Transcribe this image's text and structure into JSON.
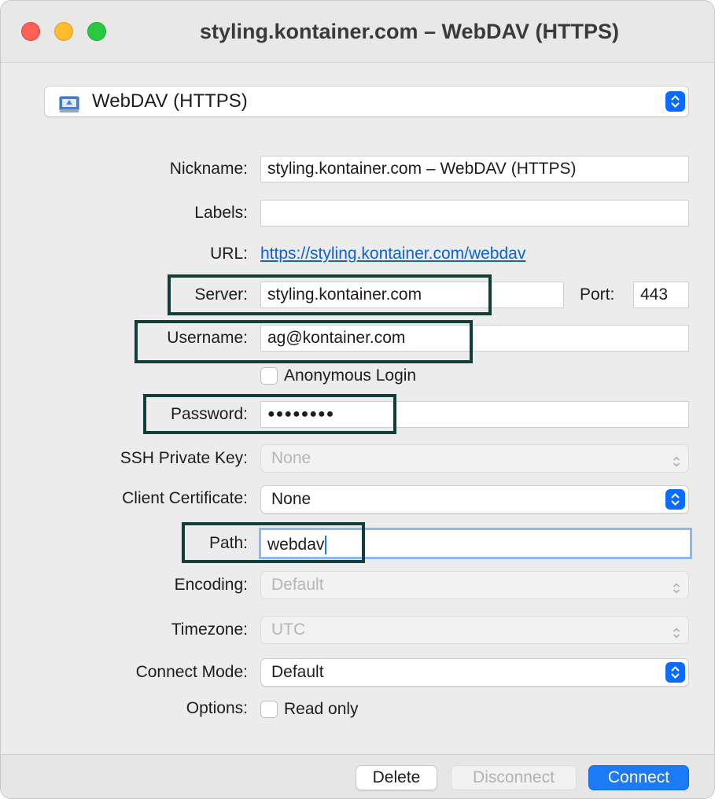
{
  "window": {
    "title": "styling.kontainer.com – WebDAV (HTTPS)"
  },
  "protocol": {
    "selected": "WebDAV (HTTPS)",
    "icon": "network-drive-icon"
  },
  "form": {
    "nickname": {
      "label": "Nickname:",
      "value": "styling.kontainer.com – WebDAV (HTTPS)"
    },
    "labels": {
      "label": "Labels:",
      "value": ""
    },
    "url": {
      "label": "URL:",
      "value": "https://styling.kontainer.com/webdav"
    },
    "server": {
      "label": "Server:",
      "value": "styling.kontainer.com"
    },
    "port": {
      "label": "Port:",
      "value": "443"
    },
    "username": {
      "label": "Username:",
      "value": "ag@kontainer.com"
    },
    "anonymous": {
      "label": "Anonymous Login",
      "checked": false
    },
    "password": {
      "label": "Password:",
      "value": "●●●●●●●●"
    },
    "ssh_key": {
      "label": "SSH Private Key:",
      "value": "None"
    },
    "client_cert": {
      "label": "Client Certificate:",
      "value": "None"
    },
    "path": {
      "label": "Path:",
      "value": "webdav"
    },
    "encoding": {
      "label": "Encoding:",
      "value": "Default"
    },
    "timezone": {
      "label": "Timezone:",
      "value": "UTC"
    },
    "connect_mode": {
      "label": "Connect Mode:",
      "value": "Default"
    },
    "options": {
      "label": "Options:",
      "read_only_label": "Read only",
      "read_only_checked": false
    }
  },
  "buttons": {
    "delete": "Delete",
    "disconnect": "Disconnect",
    "connect": "Connect"
  },
  "colors": {
    "accent": "#1a7af8",
    "highlight_box": "#123e3a",
    "link": "#0b63d6"
  }
}
